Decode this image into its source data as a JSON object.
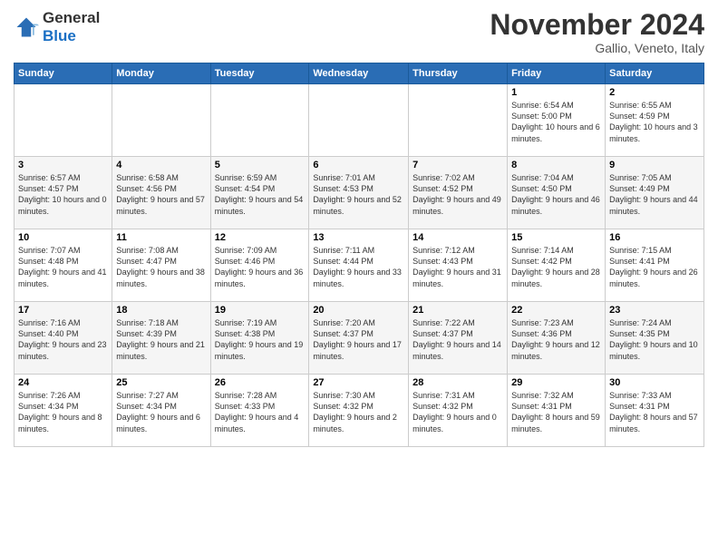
{
  "header": {
    "logo_line1": "General",
    "logo_line2": "Blue",
    "month_title": "November 2024",
    "location": "Gallio, Veneto, Italy"
  },
  "weekdays": [
    "Sunday",
    "Monday",
    "Tuesday",
    "Wednesday",
    "Thursday",
    "Friday",
    "Saturday"
  ],
  "weeks": [
    [
      {
        "day": "",
        "info": ""
      },
      {
        "day": "",
        "info": ""
      },
      {
        "day": "",
        "info": ""
      },
      {
        "day": "",
        "info": ""
      },
      {
        "day": "",
        "info": ""
      },
      {
        "day": "1",
        "info": "Sunrise: 6:54 AM\nSunset: 5:00 PM\nDaylight: 10 hours\nand 6 minutes."
      },
      {
        "day": "2",
        "info": "Sunrise: 6:55 AM\nSunset: 4:59 PM\nDaylight: 10 hours\nand 3 minutes."
      }
    ],
    [
      {
        "day": "3",
        "info": "Sunrise: 6:57 AM\nSunset: 4:57 PM\nDaylight: 10 hours\nand 0 minutes."
      },
      {
        "day": "4",
        "info": "Sunrise: 6:58 AM\nSunset: 4:56 PM\nDaylight: 9 hours\nand 57 minutes."
      },
      {
        "day": "5",
        "info": "Sunrise: 6:59 AM\nSunset: 4:54 PM\nDaylight: 9 hours\nand 54 minutes."
      },
      {
        "day": "6",
        "info": "Sunrise: 7:01 AM\nSunset: 4:53 PM\nDaylight: 9 hours\nand 52 minutes."
      },
      {
        "day": "7",
        "info": "Sunrise: 7:02 AM\nSunset: 4:52 PM\nDaylight: 9 hours\nand 49 minutes."
      },
      {
        "day": "8",
        "info": "Sunrise: 7:04 AM\nSunset: 4:50 PM\nDaylight: 9 hours\nand 46 minutes."
      },
      {
        "day": "9",
        "info": "Sunrise: 7:05 AM\nSunset: 4:49 PM\nDaylight: 9 hours\nand 44 minutes."
      }
    ],
    [
      {
        "day": "10",
        "info": "Sunrise: 7:07 AM\nSunset: 4:48 PM\nDaylight: 9 hours\nand 41 minutes."
      },
      {
        "day": "11",
        "info": "Sunrise: 7:08 AM\nSunset: 4:47 PM\nDaylight: 9 hours\nand 38 minutes."
      },
      {
        "day": "12",
        "info": "Sunrise: 7:09 AM\nSunset: 4:46 PM\nDaylight: 9 hours\nand 36 minutes."
      },
      {
        "day": "13",
        "info": "Sunrise: 7:11 AM\nSunset: 4:44 PM\nDaylight: 9 hours\nand 33 minutes."
      },
      {
        "day": "14",
        "info": "Sunrise: 7:12 AM\nSunset: 4:43 PM\nDaylight: 9 hours\nand 31 minutes."
      },
      {
        "day": "15",
        "info": "Sunrise: 7:14 AM\nSunset: 4:42 PM\nDaylight: 9 hours\nand 28 minutes."
      },
      {
        "day": "16",
        "info": "Sunrise: 7:15 AM\nSunset: 4:41 PM\nDaylight: 9 hours\nand 26 minutes."
      }
    ],
    [
      {
        "day": "17",
        "info": "Sunrise: 7:16 AM\nSunset: 4:40 PM\nDaylight: 9 hours\nand 23 minutes."
      },
      {
        "day": "18",
        "info": "Sunrise: 7:18 AM\nSunset: 4:39 PM\nDaylight: 9 hours\nand 21 minutes."
      },
      {
        "day": "19",
        "info": "Sunrise: 7:19 AM\nSunset: 4:38 PM\nDaylight: 9 hours\nand 19 minutes."
      },
      {
        "day": "20",
        "info": "Sunrise: 7:20 AM\nSunset: 4:37 PM\nDaylight: 9 hours\nand 17 minutes."
      },
      {
        "day": "21",
        "info": "Sunrise: 7:22 AM\nSunset: 4:37 PM\nDaylight: 9 hours\nand 14 minutes."
      },
      {
        "day": "22",
        "info": "Sunrise: 7:23 AM\nSunset: 4:36 PM\nDaylight: 9 hours\nand 12 minutes."
      },
      {
        "day": "23",
        "info": "Sunrise: 7:24 AM\nSunset: 4:35 PM\nDaylight: 9 hours\nand 10 minutes."
      }
    ],
    [
      {
        "day": "24",
        "info": "Sunrise: 7:26 AM\nSunset: 4:34 PM\nDaylight: 9 hours\nand 8 minutes."
      },
      {
        "day": "25",
        "info": "Sunrise: 7:27 AM\nSunset: 4:34 PM\nDaylight: 9 hours\nand 6 minutes."
      },
      {
        "day": "26",
        "info": "Sunrise: 7:28 AM\nSunset: 4:33 PM\nDaylight: 9 hours\nand 4 minutes."
      },
      {
        "day": "27",
        "info": "Sunrise: 7:30 AM\nSunset: 4:32 PM\nDaylight: 9 hours\nand 2 minutes."
      },
      {
        "day": "28",
        "info": "Sunrise: 7:31 AM\nSunset: 4:32 PM\nDaylight: 9 hours\nand 0 minutes."
      },
      {
        "day": "29",
        "info": "Sunrise: 7:32 AM\nSunset: 4:31 PM\nDaylight: 8 hours\nand 59 minutes."
      },
      {
        "day": "30",
        "info": "Sunrise: 7:33 AM\nSunset: 4:31 PM\nDaylight: 8 hours\nand 57 minutes."
      }
    ]
  ]
}
